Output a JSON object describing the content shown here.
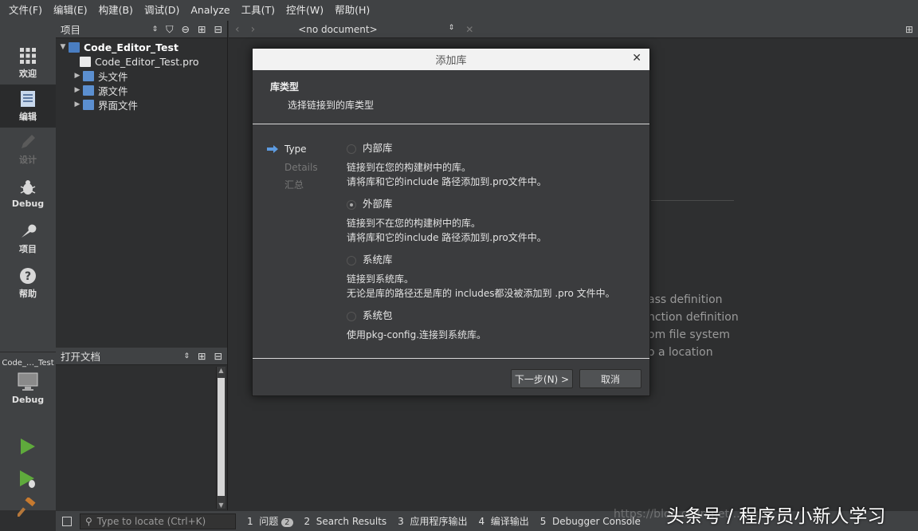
{
  "menu": [
    "文件(F)",
    "编辑(E)",
    "构建(B)",
    "调试(D)",
    "Analyze",
    "工具(T)",
    "控件(W)",
    "帮助(H)"
  ],
  "modes": {
    "welcome": "欢迎",
    "edit": "编辑",
    "design": "设计",
    "debug": "Debug",
    "projects": "项目",
    "help": "帮助"
  },
  "target": {
    "project": "Code_…_Test",
    "config": "Debug"
  },
  "project_panel": {
    "title": "项目",
    "root": "Code_Editor_Test",
    "items": [
      {
        "label": "Code_Editor_Test.pro"
      },
      {
        "label": "头文件"
      },
      {
        "label": "源文件"
      },
      {
        "label": "界面文件"
      }
    ]
  },
  "open_docs": {
    "title": "打开文档"
  },
  "editor": {
    "document": "<no document>",
    "bg_lines": [
      "ass definition",
      "nction definition",
      "om file system",
      "o a location"
    ]
  },
  "dialog": {
    "title": "添加库",
    "heading": "库类型",
    "subheading": "选择链接到的库类型",
    "steps": [
      "Type",
      "Details",
      "汇总"
    ],
    "options": [
      {
        "label": "内部库",
        "desc1": "链接到在您的构建树中的库。",
        "desc2": "请将库和它的include 路径添加到.pro文件中。",
        "selected": false
      },
      {
        "label": "外部库",
        "desc1": "链接到不在您的构建树中的库。",
        "desc2": "请将库和它的include 路径添加到.pro文件中。",
        "selected": true
      },
      {
        "label": "系统库",
        "desc1": "链接到系统库。",
        "desc2": "无论是库的路径还是库的 includes都没被添加到 .pro 文件中。",
        "selected": false
      },
      {
        "label": "系统包",
        "desc1": "使用pkg-config.连接到系统库。",
        "desc2": "",
        "selected": false
      }
    ],
    "next_button": "下一步(N) >",
    "cancel_button": "取消"
  },
  "statusbar": {
    "locator_placeholder": "Type to locate (Ctrl+K)",
    "outputs": [
      {
        "num": "1",
        "label": "问题",
        "badge": "2"
      },
      {
        "num": "2",
        "label": "Search Results"
      },
      {
        "num": "3",
        "label": "应用程序输出"
      },
      {
        "num": "4",
        "label": "编译输出"
      },
      {
        "num": "5",
        "label": "Debugger Console"
      }
    ]
  },
  "watermark": {
    "url": "https://blog.csdn.net/...",
    "text": "头条号 / 程序员小新人学习"
  }
}
